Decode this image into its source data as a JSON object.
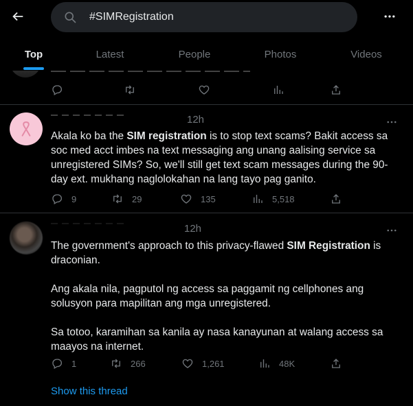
{
  "search": {
    "query": "#SIMRegistration"
  },
  "tabs": [
    "Top",
    "Latest",
    "People",
    "Photos",
    "Videos"
  ],
  "active_tab": "Top",
  "tweets": [
    {
      "time": "12h",
      "text_parts": [
        [
          {
            "t": "Akala ko ba the ",
            "b": false
          },
          {
            "t": "SIM registration",
            "b": true
          },
          {
            "t": " is to stop text scams? Bakit access sa soc med acct imbes na text messaging ang unang aalising service sa unregistered SIMs? So, we'll still get text scam messages during the 90-day ext. mukhang naglolokahan na lang tayo pag ganito.",
            "b": false
          }
        ]
      ],
      "replies": "9",
      "retweets": "29",
      "likes": "135",
      "views": "5,518"
    },
    {
      "time": "12h",
      "text_parts": [
        [
          {
            "t": "The government's approach to this privacy-flawed ",
            "b": false
          },
          {
            "t": "SIM Registration",
            "b": true
          },
          {
            "t": " is draconian.",
            "b": false
          }
        ],
        [
          {
            "t": "Ang akala nila, pagputol ng access sa paggamit ng cellphones ang solusyon para mapilitan ang mga unregistered.",
            "b": false
          }
        ],
        [
          {
            "t": "Sa totoo, karamihan sa kanila ay nasa kanayunan at walang access sa maayos na internet.",
            "b": false
          }
        ]
      ],
      "replies": "1",
      "retweets": "266",
      "likes": "1,261",
      "views": "48K"
    }
  ],
  "show_thread_label": "Show this thread",
  "colors": {
    "accent": "#1d9bf0",
    "muted": "#71767b",
    "text": "#e7e9ea",
    "divider": "#2f3336"
  }
}
